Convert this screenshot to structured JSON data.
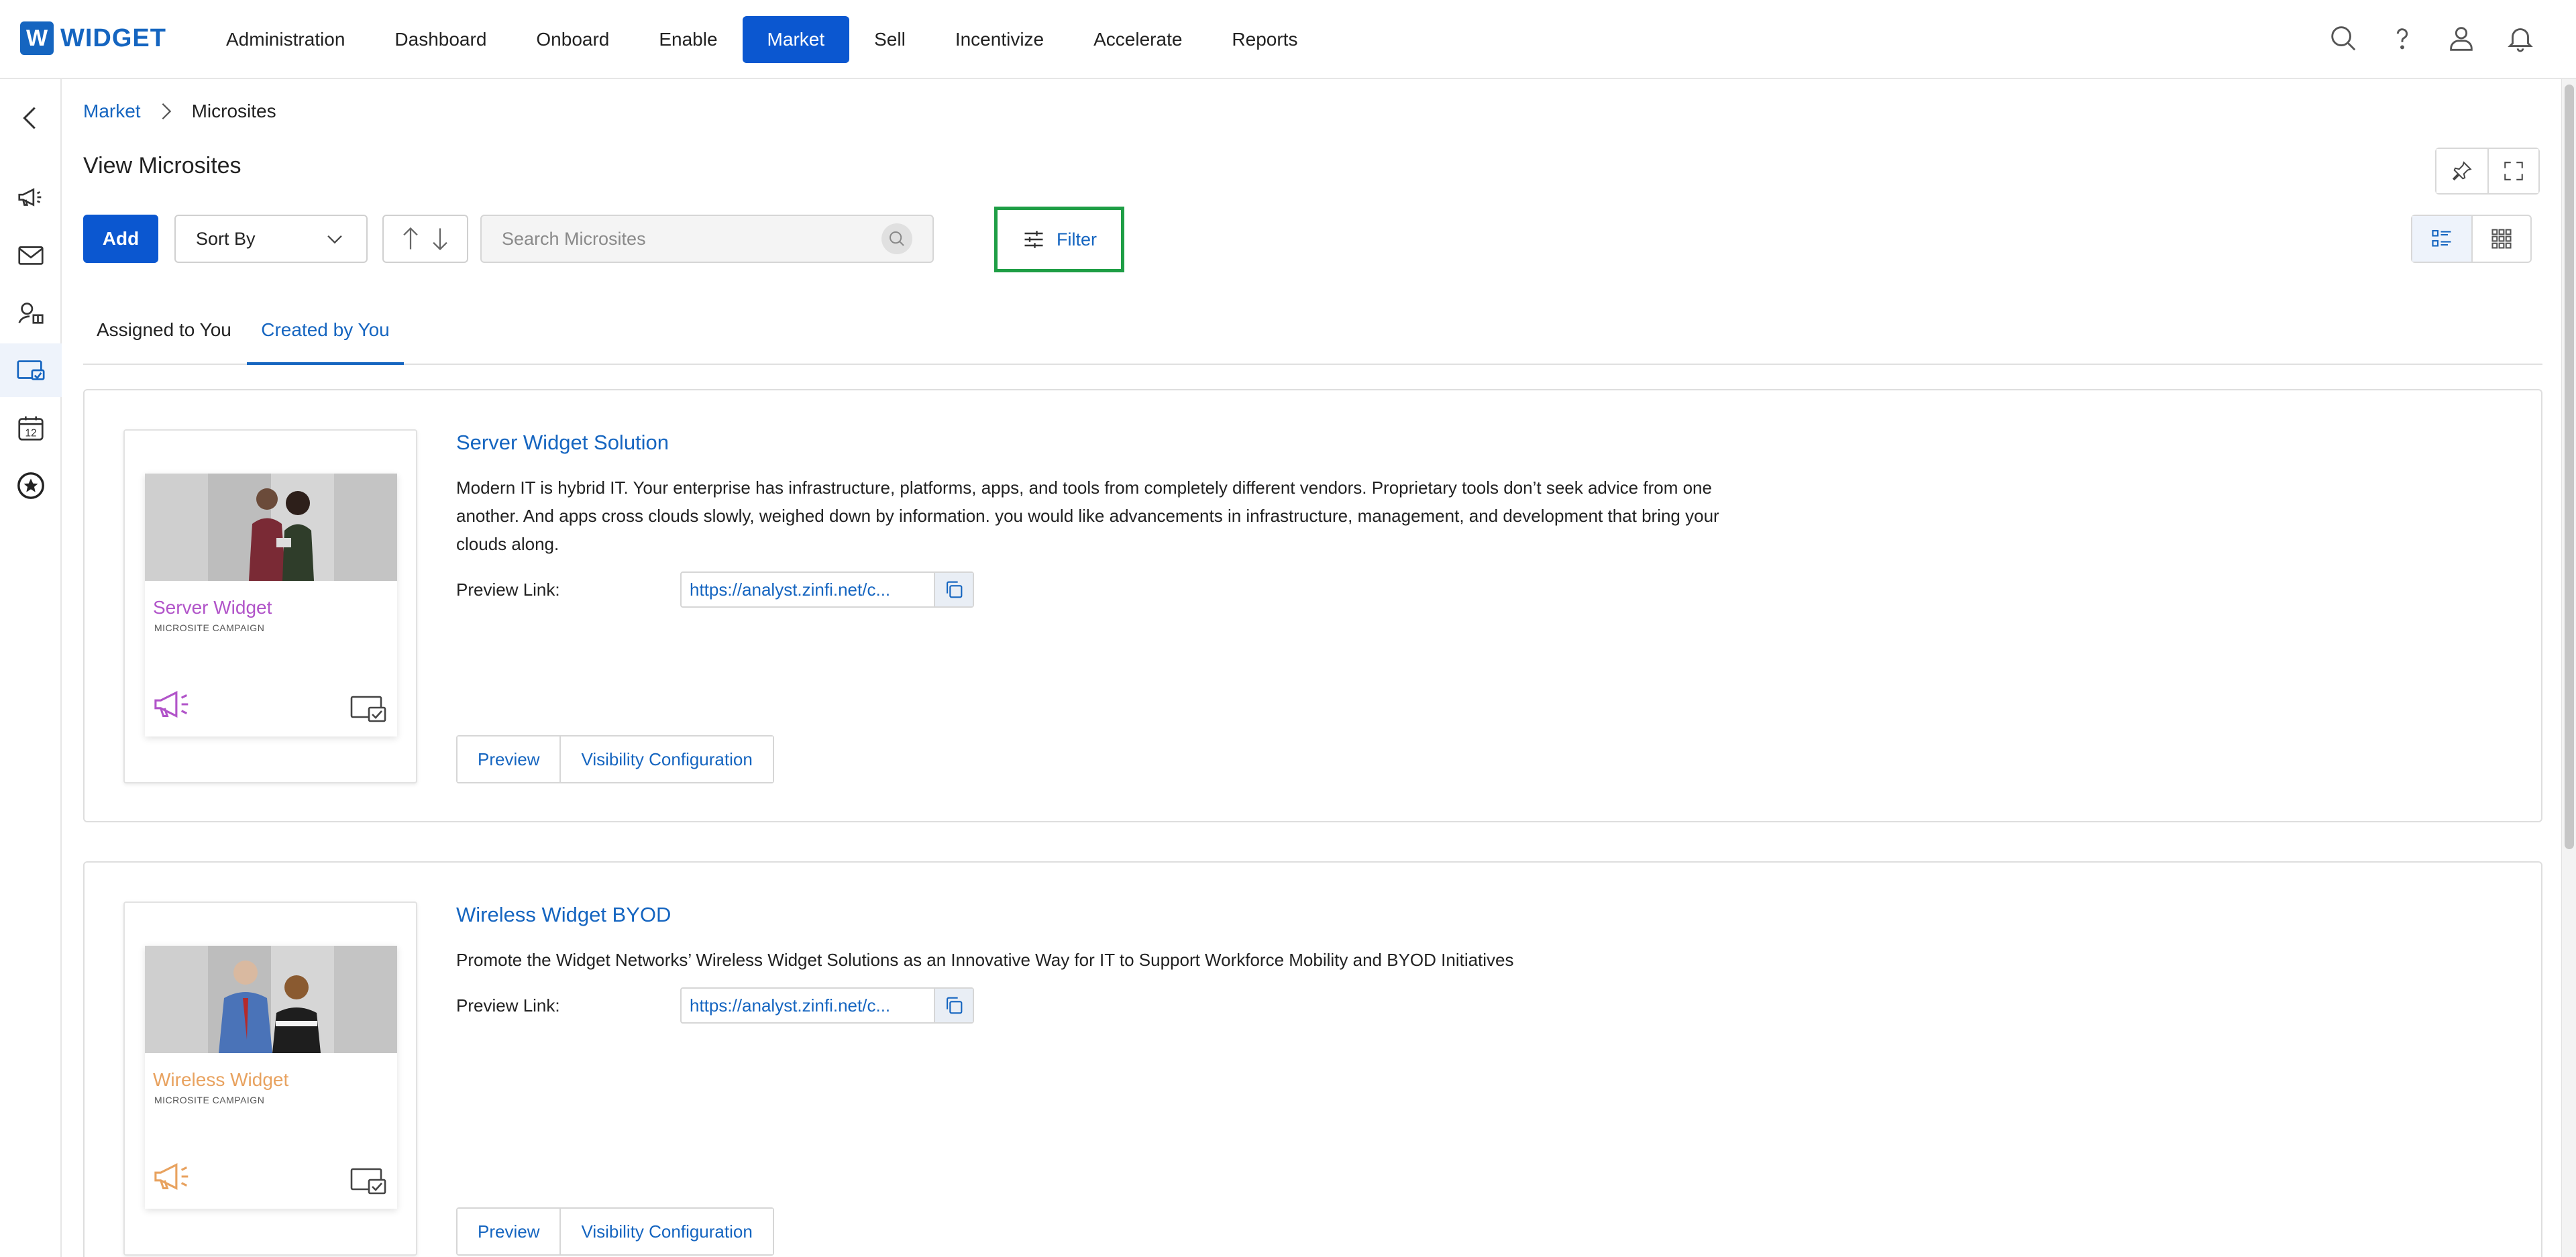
{
  "brand": {
    "mark": "W",
    "name": "WIDGET"
  },
  "nav": [
    {
      "label": "Administration",
      "active": false
    },
    {
      "label": "Dashboard",
      "active": false
    },
    {
      "label": "Onboard",
      "active": false
    },
    {
      "label": "Enable",
      "active": false
    },
    {
      "label": "Market",
      "active": true
    },
    {
      "label": "Sell",
      "active": false
    },
    {
      "label": "Incentivize",
      "active": false
    },
    {
      "label": "Accelerate",
      "active": false
    },
    {
      "label": "Reports",
      "active": false
    }
  ],
  "top_icons": [
    "search-icon",
    "help-icon",
    "user-icon",
    "bell-icon"
  ],
  "sidebar_icons": [
    "back-chevron-icon",
    "megaphone-icon",
    "mail-icon",
    "gift-icon",
    "microsite-icon",
    "calendar-icon",
    "star-badge-icon"
  ],
  "sidebar_active": "microsite-icon",
  "calendar_day": "12",
  "breadcrumb": {
    "parent": "Market",
    "current": "Microsites"
  },
  "page": {
    "title": "View Microsites"
  },
  "toolbar": {
    "add_label": "Add",
    "sort_label": "Sort By",
    "search_placeholder": "Search Microsites",
    "filter_label": "Filter"
  },
  "tabs": [
    {
      "label": "Assigned to You",
      "active": false
    },
    {
      "label": "Created by You",
      "active": true
    }
  ],
  "colors": {
    "primary": "#0b57d0",
    "link": "#1565c0",
    "filter_highlight": "#1e9e45",
    "server_accent": "#b154c9",
    "wireless_accent": "#e8a25f"
  },
  "microsites": [
    {
      "thumb_title": "Server Widget",
      "thumb_sub": "MICROSITE CAMPAIGN",
      "title": "Server Widget Solution",
      "description": "Modern IT is hybrid IT. Your enterprise has infrastructure, platforms, apps, and tools from completely different vendors. Proprietary tools don’t seek advice from one another. And apps cross clouds slowly, weighed down by information. you would like advancements in infrastructure, management, and development that bring your clouds along.",
      "preview_label": "Preview Link:",
      "preview_link": "https://analyst.zinfi.net/c...",
      "actions": [
        "Preview",
        "Visibility Configuration"
      ]
    },
    {
      "thumb_title": "Wireless Widget",
      "thumb_sub": "MICROSITE CAMPAIGN",
      "title": "Wireless Widget BYOD",
      "description": "Promote the Widget Networks’ Wireless Widget Solutions as an Innovative Way for IT to Support Workforce Mobility and BYOD Initiatives",
      "preview_label": "Preview Link:",
      "preview_link": "https://analyst.zinfi.net/c...",
      "actions": [
        "Preview",
        "Visibility Configuration"
      ]
    }
  ]
}
